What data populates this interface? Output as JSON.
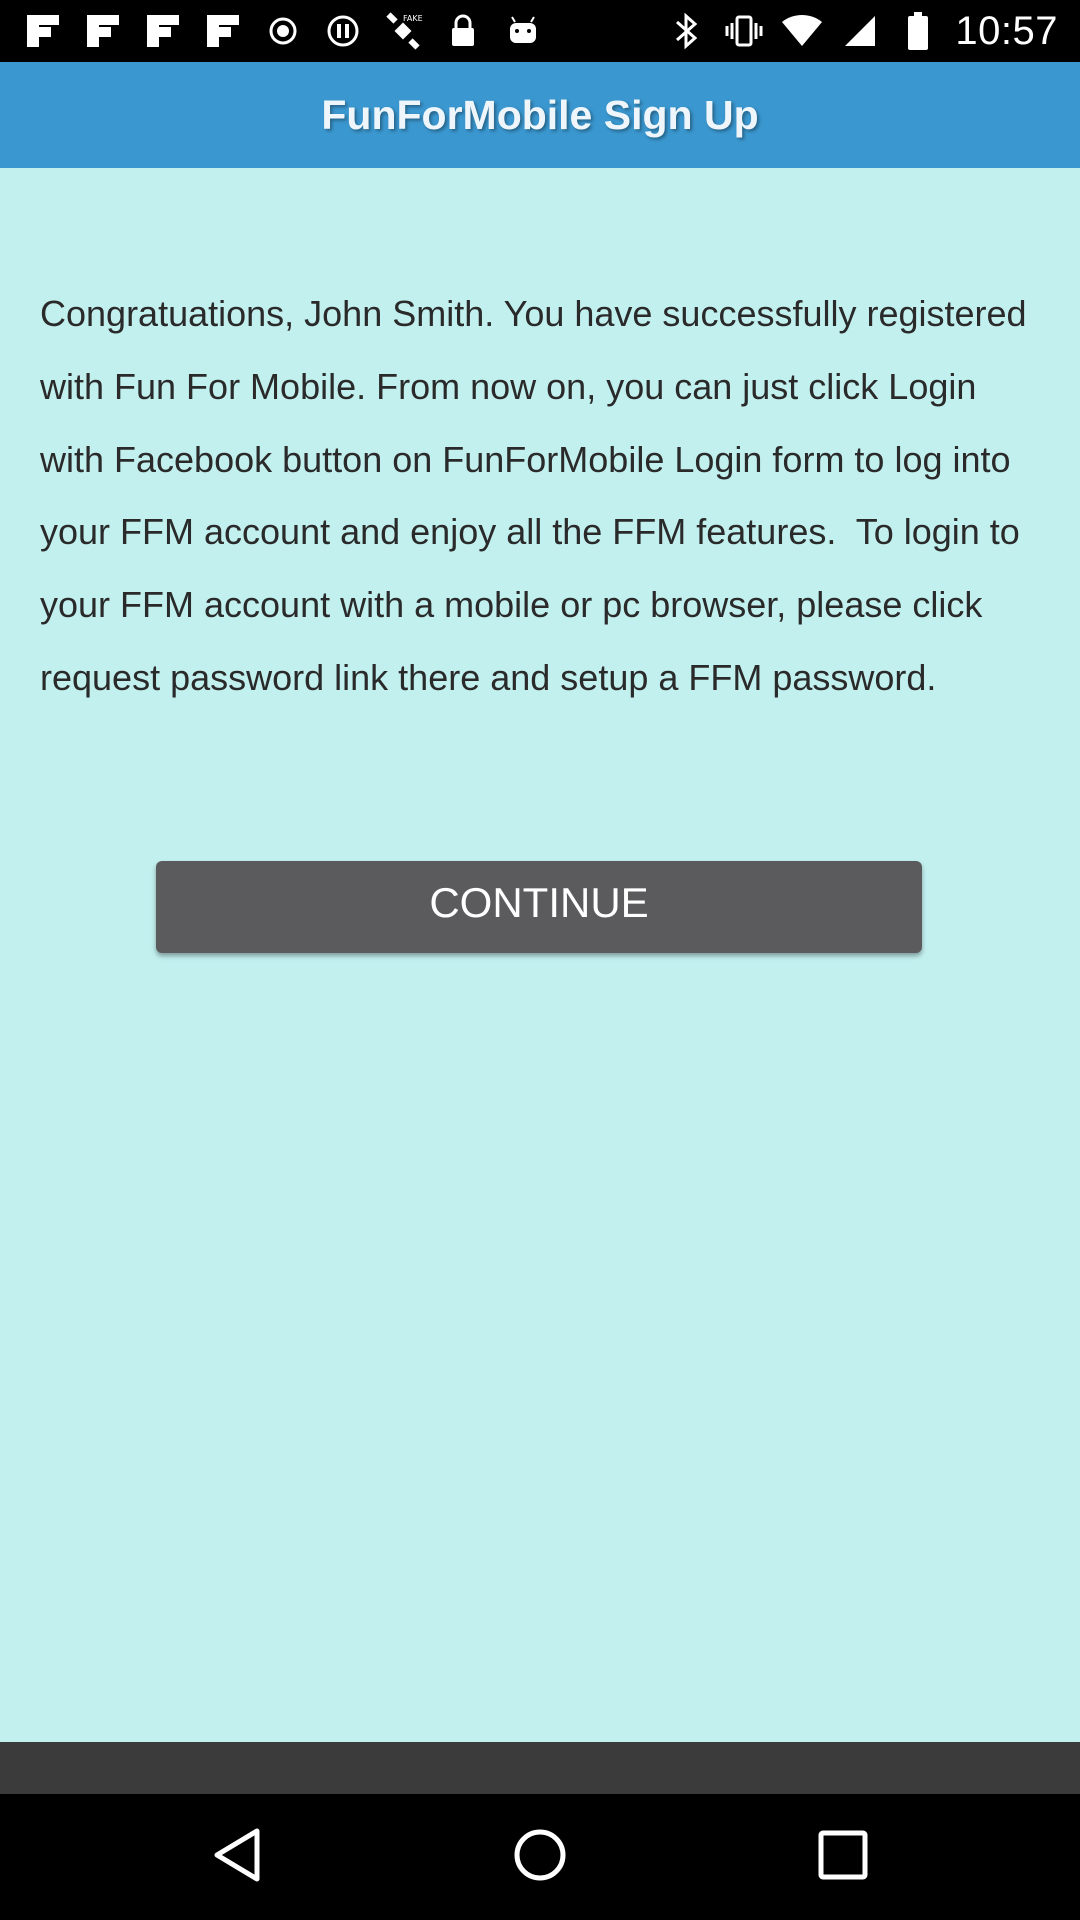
{
  "status_bar": {
    "time": "10:57",
    "left_icons": [
      "flipboard-icon",
      "flipboard-icon",
      "flipboard-icon",
      "flipboard-icon",
      "record-icon",
      "blocked-icon",
      "satellite-icon",
      "lock-icon",
      "android-icon"
    ],
    "right_icons": [
      "bluetooth-icon",
      "vibrate-icon",
      "wifi-icon",
      "signal-icon",
      "battery-icon"
    ]
  },
  "header": {
    "title": "FunForMobile Sign Up"
  },
  "main": {
    "message": "Congratuations, John Smith. You have successfully registered with Fun For Mobile. From now on, you can just click Login with Facebook button on FunForMobile Login form to log into your FFM account and enjoy all the FFM features.  To login to your FFM account with a mobile or pc browser, please click request password link there and setup a FFM password.",
    "continue_label": "CONTINUE"
  },
  "colors": {
    "header_bg": "#3a97cf",
    "content_bg": "#c2f0ef",
    "button_bg": "#5b5b5e"
  },
  "nav_bar": {
    "buttons": [
      "back-icon",
      "home-icon",
      "recents-icon"
    ]
  }
}
